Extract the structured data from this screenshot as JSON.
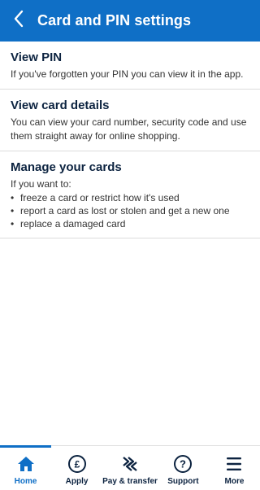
{
  "header": {
    "title": "Card and PIN settings",
    "back_icon": "chevron-left-icon"
  },
  "items": [
    {
      "title": "View PIN",
      "description": "If you've forgotten your PIN you can view it in the app."
    },
    {
      "title": "View card details",
      "description": "You can view your card number, security code and use them straight away for online shopping."
    },
    {
      "title": "Manage your cards",
      "description": "If you want to:",
      "bullets": [
        "freeze a card or restrict how it's used",
        "report a card as lost or stolen and get a new one",
        "replace a damaged card"
      ]
    }
  ],
  "bottom_nav": {
    "active": "Home",
    "items": [
      {
        "label": "Home",
        "icon": "home-icon"
      },
      {
        "label": "Apply",
        "icon": "pound-icon"
      },
      {
        "label": "Pay & transfer",
        "icon": "transfer-icon"
      },
      {
        "label": "Support",
        "icon": "question-icon"
      },
      {
        "label": "More",
        "icon": "menu-icon"
      }
    ]
  },
  "colors": {
    "header_bg": "#0f6fc6",
    "title_text": "#0c2340",
    "active_nav": "#0f6fc6"
  }
}
